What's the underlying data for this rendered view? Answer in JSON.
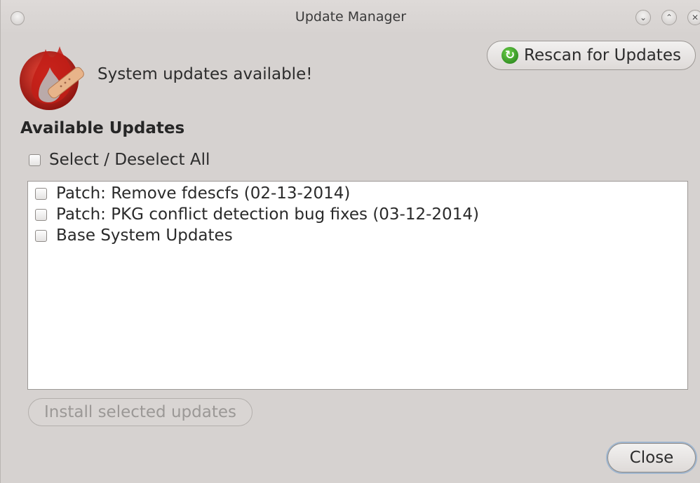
{
  "window": {
    "title": "Update Manager"
  },
  "header": {
    "status_text": "System updates available!",
    "rescan_label": "Rescan for Updates",
    "rescan_icon": "refresh-icon"
  },
  "updates": {
    "section_title": "Available Updates",
    "select_all_label": "Select / Deselect All",
    "select_all_checked": false,
    "items": [
      {
        "label": "Patch: Remove fdescfs (02-13-2014)",
        "checked": false
      },
      {
        "label": "Patch: PKG conflict detection bug fixes (03-12-2014)",
        "checked": false
      },
      {
        "label": "Base System Updates",
        "checked": false
      }
    ]
  },
  "actions": {
    "install_label": "Install selected updates",
    "install_enabled": false,
    "close_label": "Close"
  },
  "colors": {
    "window_bg": "#d6d2d0",
    "list_bg": "#ffffff",
    "disabled_text": "#9b9896",
    "refresh_green": "#2e8b20"
  }
}
